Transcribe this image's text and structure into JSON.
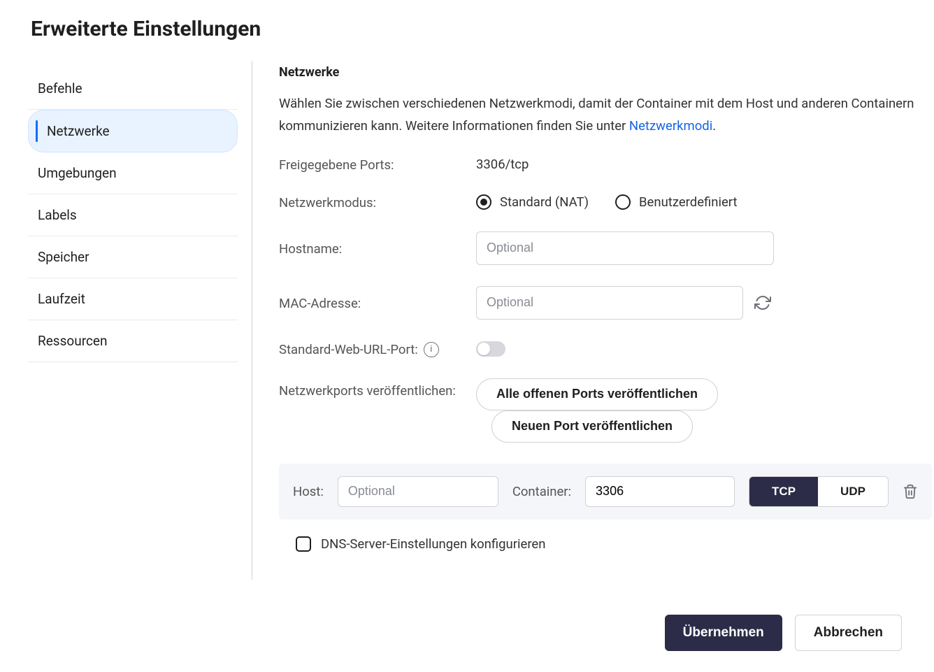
{
  "page_title": "Erweiterte Einstellungen",
  "sidebar": {
    "items": [
      {
        "label": "Befehle"
      },
      {
        "label": "Netzwerke"
      },
      {
        "label": "Umgebungen"
      },
      {
        "label": "Labels"
      },
      {
        "label": "Speicher"
      },
      {
        "label": "Laufzeit"
      },
      {
        "label": "Ressourcen"
      }
    ],
    "active_index": 1
  },
  "content": {
    "heading": "Netzwerke",
    "description_pre": "Wählen Sie zwischen verschiedenen Netzwerkmodi, damit der Container mit dem Host und anderen Containern kommunizieren kann. Weitere Informationen finden Sie unter ",
    "description_link": "Netzwerkmodi",
    "description_post": ".",
    "exposed_ports_label": "Freigegebene Ports:",
    "exposed_ports_value": "3306/tcp",
    "network_mode_label": "Netzwerkmodus:",
    "network_mode_options": {
      "standard": "Standard (NAT)",
      "custom": "Benutzerdefiniert"
    },
    "network_mode_selected": "standard",
    "hostname_label": "Hostname:",
    "hostname_placeholder": "Optional",
    "mac_label": "MAC-Adresse:",
    "mac_placeholder": "Optional",
    "web_url_port_label": "Standard-Web-URL-Port:",
    "web_url_port_enabled": false,
    "publish_ports_label": "Netzwerkports veröffentlichen:",
    "publish_all_btn": "Alle offenen Ports veröffentlichen",
    "publish_new_btn": "Neuen Port veröffentlichen",
    "port_row": {
      "host_label": "Host:",
      "host_placeholder": "Optional",
      "host_value": "",
      "container_label": "Container:",
      "container_value": "3306",
      "tcp_label": "TCP",
      "udp_label": "UDP",
      "protocol_selected": "TCP"
    },
    "dns_checkbox_label": "DNS-Server-Einstellungen konfigurieren"
  },
  "footer": {
    "apply": "Übernehmen",
    "cancel": "Abbrechen"
  }
}
